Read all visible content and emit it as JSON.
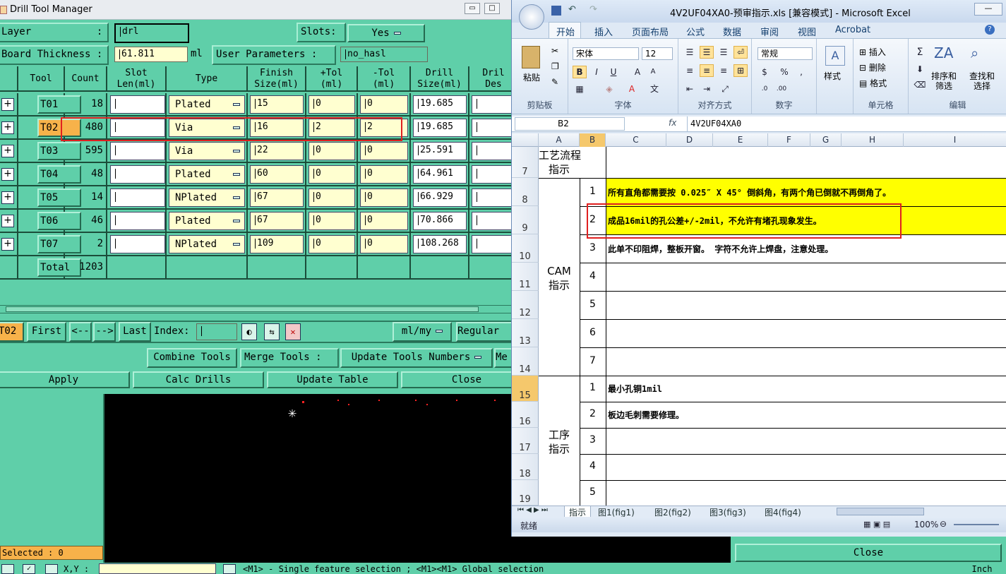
{
  "drill": {
    "title": "Drill Tool Manager",
    "layer_label": "Layer           :",
    "layer_value": "drl",
    "slots_label": "Slots:",
    "slots_value": "Yes",
    "thickness_label": "Board Thickness :",
    "thickness_value": "61.811",
    "thickness_unit": "ml",
    "user_params_label": "User Parameters :",
    "user_params_value": "no_hasl",
    "columns": [
      "Tool",
      "Count",
      "Slot\nLen(ml)",
      "Type",
      "Finish\nSize(ml)",
      "+Tol\n(ml)",
      "-Tol\n(ml)",
      "Drill\nSize(ml)",
      "Dril\nDes"
    ],
    "rows": [
      {
        "tool": "T01",
        "count": "18",
        "type": "Plated",
        "finish": "15",
        "ptol": "0",
        "ntol": "0",
        "drill": "19.685"
      },
      {
        "tool": "T02",
        "count": "480",
        "type": "Via",
        "finish": "16",
        "ptol": "2",
        "ntol": "2",
        "drill": "19.685"
      },
      {
        "tool": "T03",
        "count": "595",
        "type": "Via",
        "finish": "22",
        "ptol": "0",
        "ntol": "0",
        "drill": "25.591"
      },
      {
        "tool": "T04",
        "count": "48",
        "type": "Plated",
        "finish": "60",
        "ptol": "0",
        "ntol": "0",
        "drill": "64.961"
      },
      {
        "tool": "T05",
        "count": "14",
        "type": "NPlated",
        "finish": "67",
        "ptol": "0",
        "ntol": "0",
        "drill": "66.929"
      },
      {
        "tool": "T06",
        "count": "46",
        "type": "Plated",
        "finish": "67",
        "ptol": "0",
        "ntol": "0",
        "drill": "70.866"
      },
      {
        "tool": "T07",
        "count": "2",
        "type": "NPlated",
        "finish": "109",
        "ptol": "0",
        "ntol": "0",
        "drill": "108.268"
      }
    ],
    "total_label": "Total",
    "total_value": "1203",
    "nav": {
      "current": "T02",
      "first": "First",
      "prev": "<--",
      "next": "-->",
      "last": "Last",
      "index_label": "Index:",
      "units": "ml/my",
      "mode": "Regular"
    },
    "combine": "Combine Tools",
    "merge_label": "Merge Tools :",
    "merge_value": "Update Tools Numbers",
    "merge_more": "Me",
    "actions": {
      "apply": "Apply",
      "calc": "Calc Drills",
      "update": "Update Table",
      "close": "Close"
    },
    "selected": "Selected : 0",
    "xy_label": "X,Y :",
    "status_text": "<M1> - Single feature selection ; <M1><M1> Global selection",
    "unit_tag": "Inch"
  },
  "excel": {
    "title": "4V2UF04XA0-预审指示.xls  [兼容模式] - Microsoft Excel",
    "tabs": [
      "开始",
      "插入",
      "页面布局",
      "公式",
      "数据",
      "审阅",
      "视图",
      "Acrobat"
    ],
    "font_name": "宋体",
    "font_size": "12",
    "number_format": "常规",
    "groups": {
      "clipboard": "剪贴板",
      "font": "字体",
      "align": "对齐方式",
      "number": "数字",
      "cells": "单元格",
      "edit": "编辑"
    },
    "paste": "粘贴",
    "style": "样式",
    "insert": "插入",
    "delete": "删除",
    "format": "格式",
    "sort": "排序和\n筛选",
    "find": "查找和\n选择",
    "name_box": "B2",
    "formula": "4V2UF04XA0",
    "fx": "fx",
    "columns": [
      "A",
      "B",
      "C",
      "D",
      "E",
      "F",
      "G",
      "H",
      "I"
    ],
    "row_numbers": [
      "7",
      "8",
      "9",
      "10",
      "11",
      "12",
      "13",
      "14",
      "15",
      "16",
      "17",
      "18",
      "19"
    ],
    "group_process": "工艺流程\n指示",
    "group_cam": "CAM\n指示",
    "group_step": "工序\n指示",
    "cam_items": [
      {
        "n": "1",
        "text": "所有直角都需要按 0.025″ X 45° 倒斜角，有两个角已倒就不再倒角了。"
      },
      {
        "n": "2",
        "text": "成品16mil的孔公差+/-2mil，不允许有堵孔现象发生。"
      },
      {
        "n": "3",
        "text": "此单不印阻焊，整板开窗。 字符不允许上焊盘，注意处理。"
      },
      {
        "n": "4",
        "text": ""
      },
      {
        "n": "5",
        "text": ""
      },
      {
        "n": "6",
        "text": ""
      },
      {
        "n": "7",
        "text": ""
      }
    ],
    "step_items": [
      {
        "n": "1",
        "text": "最小孔铜1mil"
      },
      {
        "n": "2",
        "text": "板边毛刺需要修理。"
      },
      {
        "n": "3",
        "text": ""
      },
      {
        "n": "4",
        "text": ""
      },
      {
        "n": "5",
        "text": ""
      }
    ],
    "sheet_tabs": [
      "指示",
      "图1(fig1)",
      "图2(fig2)",
      "图3(fig3)",
      "图4(fig4)"
    ],
    "status": "就绪",
    "zoom": "100%",
    "close_label": "Close",
    "highlight_color": "#ffff00",
    "selection_color": "#e02020"
  }
}
